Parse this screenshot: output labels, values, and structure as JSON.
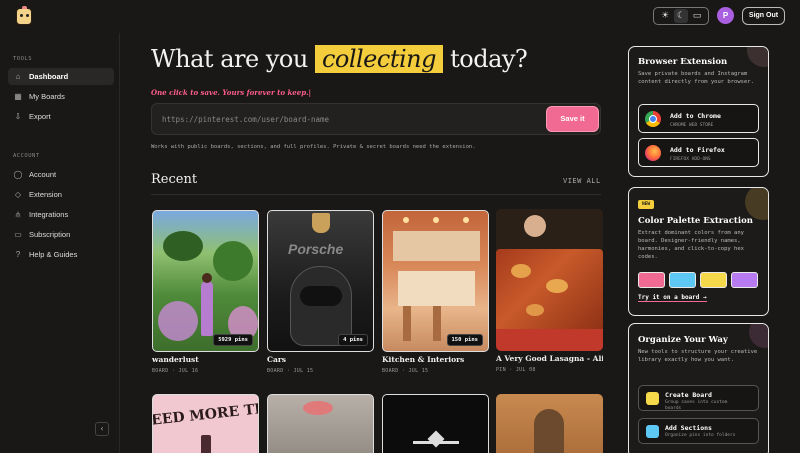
{
  "topbar": {
    "theme_icons": [
      "sun-icon",
      "moon-icon",
      "monitor-icon"
    ],
    "avatar_initial": "P",
    "signout_label": "Sign Out"
  },
  "sidebar": {
    "tools_label": "TOOLS",
    "account_label": "ACCOUNT",
    "tools": [
      {
        "label": "Dashboard",
        "icon": "home-icon",
        "glyph": "⌂",
        "active": true
      },
      {
        "label": "My Boards",
        "icon": "grid-icon",
        "glyph": "▦",
        "active": false
      },
      {
        "label": "Export",
        "icon": "export-icon",
        "glyph": "⇩",
        "active": false
      }
    ],
    "account": [
      {
        "label": "Account",
        "icon": "user-icon",
        "glyph": "◯"
      },
      {
        "label": "Extension",
        "icon": "puzzle-icon",
        "glyph": "◇"
      },
      {
        "label": "Integrations",
        "icon": "plug-icon",
        "glyph": "⫛"
      },
      {
        "label": "Subscription",
        "icon": "card-icon",
        "glyph": "▭"
      },
      {
        "label": "Help & Guides",
        "icon": "help-icon",
        "glyph": "?"
      }
    ],
    "collapse_glyph": "‹"
  },
  "main": {
    "hero_before": "What are you",
    "hero_highlight": "collecting",
    "hero_after": "today?",
    "tagline": "One click to save. Yours forever to keep.|",
    "url_placeholder": "https://pinterest.com/user/board-name",
    "save_label": "Save it",
    "helper": "Works with public boards, sections, and full profiles. Private & secret boards need the extension.",
    "recent_title": "Recent",
    "view_all": "VIEW ALL",
    "cards": [
      {
        "title": "wanderlust",
        "meta": "BOARD · JUL 16",
        "badge": "5929 pins"
      },
      {
        "title": "Cars",
        "meta": "BOARD · JUL 15",
        "badge": "4 pins",
        "overlay": "Porsche"
      },
      {
        "title": "Kitchen & Interiors",
        "meta": "BOARD · JUL 15",
        "badge": "150 pins"
      },
      {
        "title": "A Very Good Lasagna - Alis…",
        "meta": "PIN · JUL 08",
        "badge": ""
      }
    ],
    "second_row_text": "EED MORE TI"
  },
  "right": {
    "browser_ext": {
      "title": "Browser Extension",
      "desc": "Save private boards and Instagram content directly from your browser.",
      "chrome_label": "Add to Chrome",
      "chrome_sub": "CHROME WEB STORE",
      "firefox_label": "Add to Firefox",
      "firefox_sub": "FIREFOX ADD-ONS"
    },
    "palette": {
      "badge": "NEW",
      "title": "Color Palette Extraction",
      "desc": "Extract dominant colors from any board. Designer-friendly names, harmonies, and click-to-copy hex codes.",
      "swatches": [
        "#f06a93",
        "#5ec8f5",
        "#f5d94a",
        "#b77af0"
      ],
      "link": "Try it on a board →"
    },
    "organize": {
      "title": "Organize Your Way",
      "desc": "New tools to structure your creative library exactly how you want.",
      "items": [
        {
          "label": "Create Board",
          "sub1": "Group saves into custom",
          "sub2": "boards",
          "color": "#f5d94a"
        },
        {
          "label": "Add Sections",
          "sub1": "Organize pins into folders",
          "sub2": "",
          "color": "#5ec8f5"
        }
      ]
    }
  }
}
